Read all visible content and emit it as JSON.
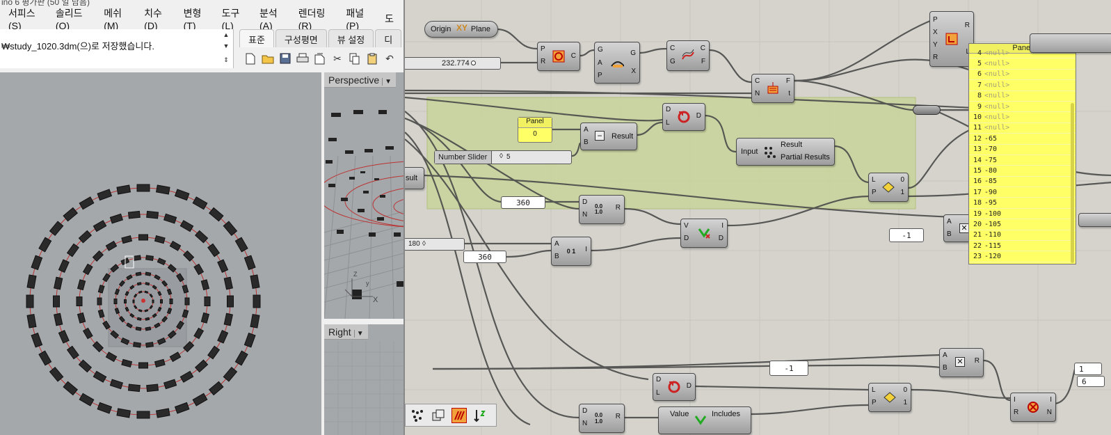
{
  "rhino": {
    "title_fragment": "ino 6 평가판 (50 일 남음)",
    "menu": [
      "서피스(S)",
      "솔리드(O)",
      "메쉬(M)",
      "치수(D)",
      "변형(T)",
      "도구(L)",
      "분석(A)",
      "렌더링(R)",
      "패널(P)",
      "도"
    ],
    "command_history": "₩study_1020.3dm(으)로 저장했습니다.",
    "tabs": [
      "표준",
      "구성평면",
      "뷰 설정",
      "디"
    ],
    "toolbar_icons": [
      "new-file-icon",
      "open-folder-icon",
      "save-icon",
      "print-icon",
      "import-icon",
      "cut-icon",
      "copy-icon",
      "paste-icon",
      "undo-icon"
    ],
    "viewports": {
      "perspective_label": "Perspective",
      "right_label": "Right",
      "axis_x": "X",
      "axis_z": "Z",
      "axis_y": "y"
    }
  },
  "gh": {
    "components": {
      "plane_left": "Origin",
      "plane_right": "Plane",
      "slider_232_value": "232.774",
      "circle_ports_in": [
        "P",
        "R"
      ],
      "circle_port_out": "C",
      "gap_ports_in": [
        "G",
        "A",
        "P"
      ],
      "gap_ports_out": [
        "G",
        "X"
      ],
      "curve_ports_in": [
        "C",
        "G"
      ],
      "curve_ports_out": [
        "C",
        "F"
      ],
      "divide_ports_in": [
        "C",
        "N"
      ],
      "divide_ports_out": [
        "F",
        "t"
      ],
      "panel_small_title": "Panel",
      "panel_small_value": "0",
      "subtract_ports_in": [
        "A",
        "B"
      ],
      "subtract_out": "Result",
      "number_slider_label": "Number Slider",
      "number_slider_value": "5",
      "shift_ports_in": [
        "D",
        "L"
      ],
      "shift_port_out": "D",
      "eval_in": "Input",
      "eval_out1": "Result",
      "eval_out2": "Partial Results",
      "result_fragment": "sult",
      "panel_360a": "360",
      "range_ports_in": [
        "D",
        "N"
      ],
      "range_port_out": "R",
      "range_numbers": "0.0 1.0",
      "split_ports_in": [
        "V",
        "D"
      ],
      "split_ports_out": [
        "I",
        "D"
      ],
      "list_item_ports_in": [
        "L",
        "P"
      ],
      "list_item_ports_out": [
        "0",
        "1"
      ],
      "slider_180_value": "180",
      "panel_360b": "360",
      "series_ports_in": [
        "A",
        "B"
      ],
      "series_port_out": "I",
      "series_numbers": "0 1",
      "panel_minus1_top": "-1",
      "mult_top_ports_in": [
        "A",
        "B"
      ],
      "pt_ports_in": [
        "P",
        "X",
        "Y",
        "R"
      ],
      "pt_ports_out": [
        "R",
        "L"
      ],
      "mult_bottom_ports_in": [
        "A",
        "B"
      ],
      "mult_bottom_port_out": "R",
      "panel_minus1_bottom": "-1",
      "shift2_ports_in": [
        "D",
        "L"
      ],
      "shift2_port_out": "D",
      "list2_ports_in": [
        "L",
        "P"
      ],
      "list2_ports_out": [
        "0",
        "1"
      ],
      "cull_ports_in": [
        "I",
        "R"
      ],
      "cull_ports_out": [
        "I",
        "N"
      ],
      "range2_ports_in": [
        "D",
        "N"
      ],
      "range2_port_out": "R",
      "member_in": "Value",
      "member_out": "Includes",
      "edge_value_1": "1",
      "edge_value_6": "6"
    },
    "panel_list": {
      "title": "Panel",
      "rows": [
        {
          "i": "4",
          "v": "<null>"
        },
        {
          "i": "5",
          "v": "<null>"
        },
        {
          "i": "6",
          "v": "<null>"
        },
        {
          "i": "7",
          "v": "<null>"
        },
        {
          "i": "8",
          "v": "<null>"
        },
        {
          "i": "9",
          "v": "<null>"
        },
        {
          "i": "10",
          "v": "<null>"
        },
        {
          "i": "11",
          "v": "<null>"
        },
        {
          "i": "12",
          "v": "-65"
        },
        {
          "i": "13",
          "v": "-70"
        },
        {
          "i": "14",
          "v": "-75"
        },
        {
          "i": "15",
          "v": "-80"
        },
        {
          "i": "16",
          "v": "-85"
        },
        {
          "i": "17",
          "v": "-90"
        },
        {
          "i": "18",
          "v": "-95"
        },
        {
          "i": "19",
          "v": "-100"
        },
        {
          "i": "20",
          "v": "-105"
        },
        {
          "i": "21",
          "v": "-110"
        },
        {
          "i": "22",
          "v": "-115"
        },
        {
          "i": "23",
          "v": "-120"
        }
      ]
    },
    "bottom_bar_icons": [
      "scatter-icon",
      "copy-canvas-icon",
      "preview-icon",
      "sort-icon"
    ],
    "colors": {
      "canvas": "#d5d3cc",
      "group": "#c7d39a",
      "panel_yellow": "#ffff66",
      "wire": "#4a4a4a"
    }
  }
}
